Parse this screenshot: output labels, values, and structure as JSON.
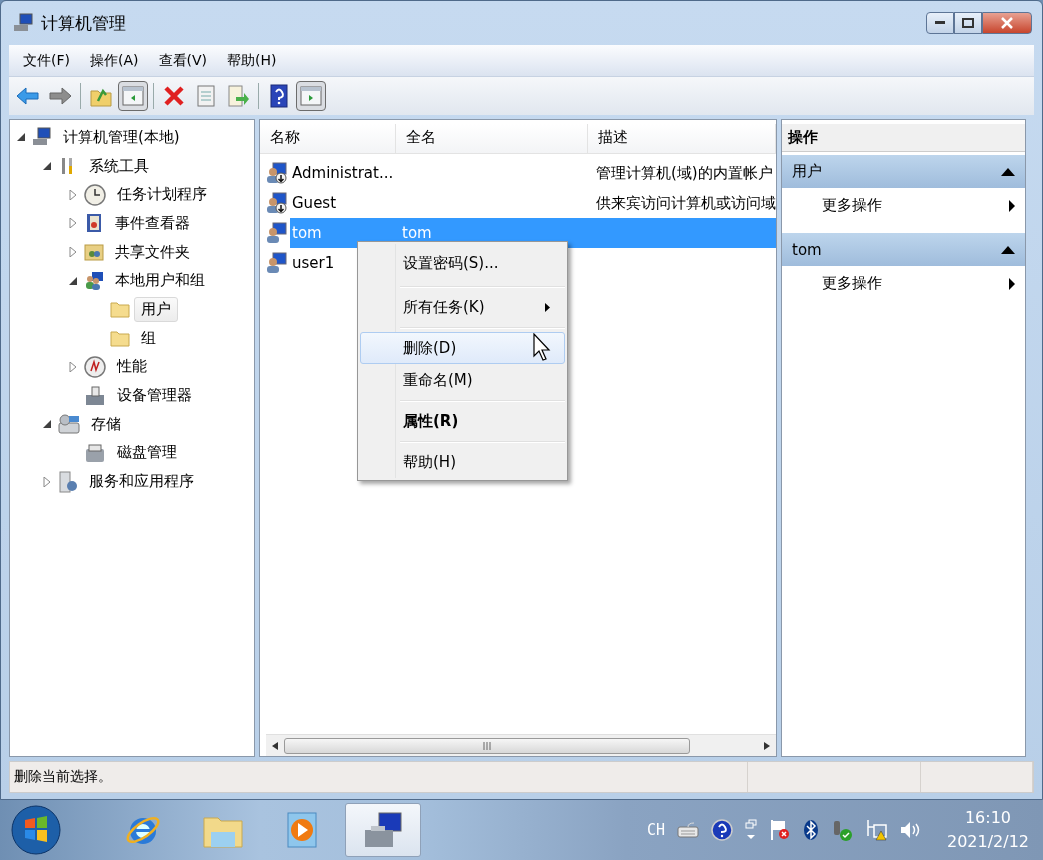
{
  "window": {
    "title": "计算机管理"
  },
  "menu": [
    {
      "label": "文件(F)"
    },
    {
      "label": "操作(A)"
    },
    {
      "label": "查看(V)"
    },
    {
      "label": "帮助(H)"
    }
  ],
  "toolbar": [
    {
      "pressed": false
    },
    {
      "pressed": false
    },
    {
      "pressed": false
    },
    {
      "pressed": true
    },
    {
      "pressed": false
    },
    {
      "pressed": false
    },
    {
      "pressed": false
    },
    {
      "pressed": false
    },
    {
      "pressed": true
    }
  ],
  "tree": [
    {
      "label": "计算机管理(本地)",
      "expanded": true,
      "selected": false,
      "children": [
        {
          "label": "系统工具",
          "expanded": true,
          "selected": false,
          "children": [
            {
              "label": "任务计划程序",
              "expanded": false,
              "selected": false
            },
            {
              "label": "事件查看器",
              "expanded": false,
              "selected": false
            },
            {
              "label": "共享文件夹",
              "expanded": false,
              "selected": false
            },
            {
              "label": "本地用户和组",
              "expanded": true,
              "selected": false,
              "children": [
                {
                  "label": "用户",
                  "selected": true
                },
                {
                  "label": "组",
                  "selected": false
                }
              ]
            },
            {
              "label": "性能",
              "expanded": false,
              "selected": false
            },
            {
              "label": "设备管理器",
              "selected": false
            }
          ]
        },
        {
          "label": "存储",
          "expanded": true,
          "selected": false,
          "children": [
            {
              "label": "磁盘管理",
              "selected": false
            }
          ]
        },
        {
          "label": "服务和应用程序",
          "expanded": false,
          "selected": false
        }
      ]
    }
  ],
  "list": {
    "columns": [
      "名称",
      "全名",
      "描述"
    ],
    "rows": [
      {
        "name": "Administrat...",
        "description": "管理计算机(域)的内置帐户",
        "disabled": true,
        "selected": false
      },
      {
        "name": "Guest",
        "description": "供来宾访问计算机或访问域",
        "disabled": true,
        "selected": false
      },
      {
        "name": "tom",
        "full_name": "tom",
        "disabled": false,
        "selected": true
      },
      {
        "name": "user1",
        "disabled": false,
        "selected": false
      }
    ]
  },
  "context_menu": [
    {
      "kind": "item",
      "label": "设置密码(S)...",
      "selected": false
    },
    {
      "kind": "separator"
    },
    {
      "kind": "submenu",
      "label": "所有任务(K)",
      "selected": false
    },
    {
      "kind": "separator"
    },
    {
      "kind": "item",
      "label": "删除(D)",
      "selected": true
    },
    {
      "kind": "item",
      "label": "重命名(M)",
      "selected": false
    },
    {
      "kind": "separator"
    },
    {
      "kind": "default",
      "label": "属性(R)",
      "selected": false
    },
    {
      "kind": "separator"
    },
    {
      "kind": "item",
      "label": "帮助(H)",
      "selected": false
    }
  ],
  "actions": {
    "title": "操作",
    "sections": [
      {
        "title": "用户",
        "expanded": true,
        "items": [
          {
            "label": "更多操作"
          }
        ]
      },
      {
        "title": "tom",
        "expanded": true,
        "items": [
          {
            "label": "更多操作"
          }
        ]
      }
    ]
  },
  "status_bar": {
    "text": "删除当前选择。"
  },
  "taskbar": {
    "apps": [
      {
        "selected": false
      },
      {
        "selected": false
      },
      {
        "selected": false
      },
      {
        "selected": true
      }
    ],
    "tray": {
      "language": "CH",
      "time": "16:10",
      "date": "2021/2/12"
    }
  }
}
